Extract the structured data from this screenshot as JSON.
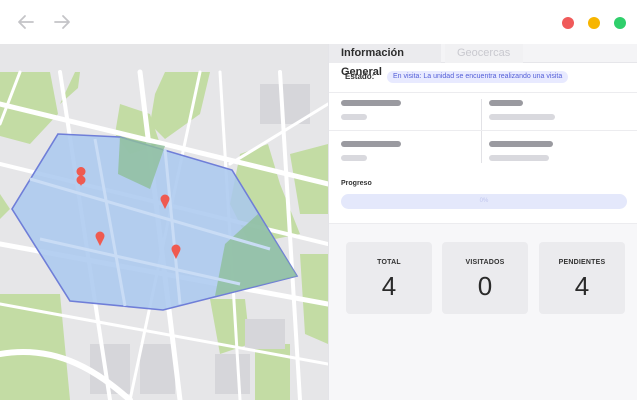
{
  "window": {
    "icons": [
      "arrow-left-icon",
      "arrow-right-icon"
    ],
    "controls": {
      "close_color": "#f05a5a",
      "minimize_color": "#f7b500",
      "maximize_color": "#2fcf6b"
    }
  },
  "map": {
    "zone_color": "#a9c8ee",
    "zone_border_color": "#6f7ed8",
    "marker_color": "#ef5a50",
    "markers": 4
  },
  "panel": {
    "tabs": [
      {
        "label": "Información General",
        "active": true
      },
      {
        "label": "Geocercas",
        "active": false
      }
    ],
    "estado": {
      "label": "Estado:",
      "badge": "En visita: La unidad se encuentra realizando una visita",
      "badge_color": "#5560d8"
    },
    "progress": {
      "label": "Progreso",
      "value_text": "0%",
      "percent": 0
    },
    "stats": [
      {
        "label": "TOTAL",
        "value": "4"
      },
      {
        "label": "VISITADOS",
        "value": "0"
      },
      {
        "label": "PENDIENTES",
        "value": "4"
      }
    ]
  }
}
